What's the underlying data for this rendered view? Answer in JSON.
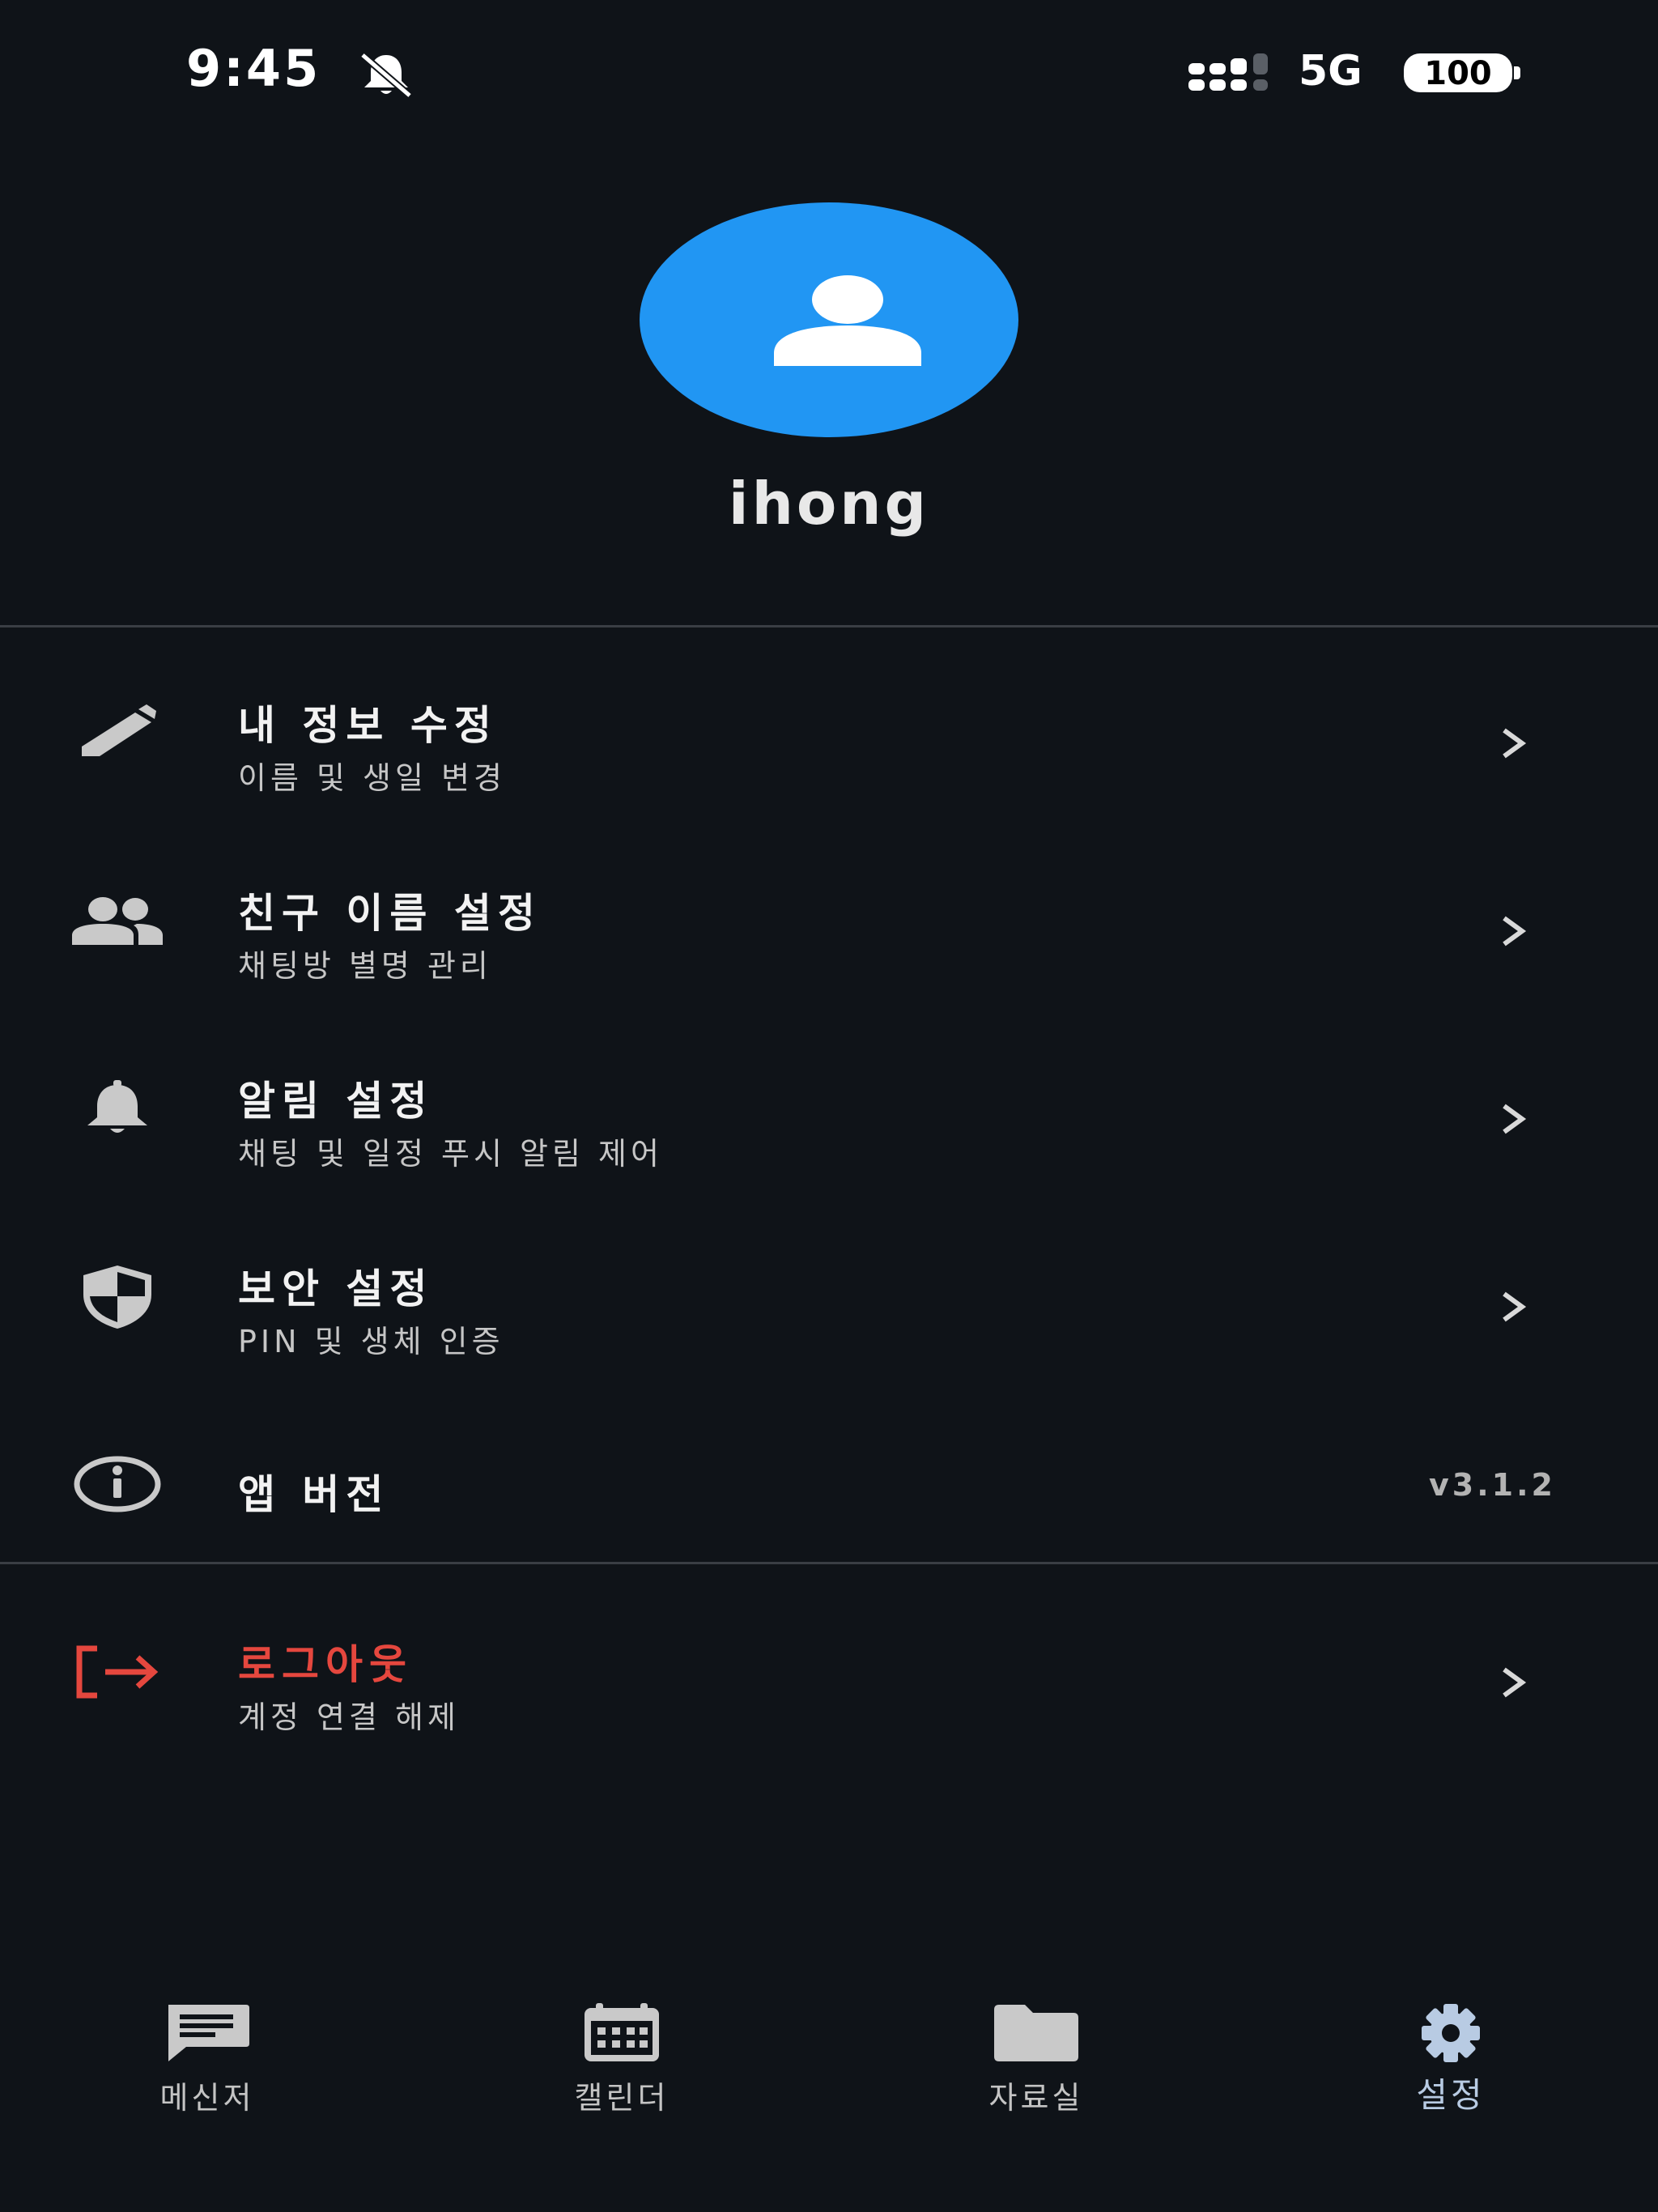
{
  "status_bar": {
    "time": "9:45",
    "network": "5G",
    "battery": "100",
    "icons": [
      "bell-off-icon",
      "signal-icon",
      "battery-icon"
    ]
  },
  "profile": {
    "username": "ihong",
    "avatar_icon": "person-icon",
    "avatar_color": "#2196f3"
  },
  "menu": {
    "edit_profile": {
      "title": "내 정보 수정",
      "subtitle": "이름 및 생일 변경",
      "icon": "pencil-icon"
    },
    "friend_names": {
      "title": "친구 이름 설정",
      "subtitle": "채팅방 별명 관리",
      "icon": "people-icon"
    },
    "notifications": {
      "title": "알림 설정",
      "subtitle": "채팅 및 일정 푸시 알림 제어",
      "icon": "bell-icon"
    },
    "security": {
      "title": "보안 설정",
      "subtitle": "PIN 및 생체 인증",
      "icon": "shield-icon"
    },
    "app_version": {
      "title": "앱 버전",
      "value": "v3.1.2",
      "icon": "info-icon"
    },
    "logout": {
      "title": "로그아웃",
      "subtitle": "계정 연결 해제",
      "icon": "logout-icon",
      "color": "#e5473e"
    }
  },
  "bottom_nav": {
    "messenger": {
      "label": "메신저",
      "icon": "chat-icon"
    },
    "calendar": {
      "label": "캘린더",
      "icon": "calendar-icon"
    },
    "files": {
      "label": "자료실",
      "icon": "folder-icon"
    },
    "settings": {
      "label": "설정",
      "icon": "gear-icon",
      "active": true
    }
  },
  "colors": {
    "background": "#0f1318",
    "accent": "#2196f3",
    "danger": "#e5473e",
    "active_nav": "#b8cbe3"
  }
}
